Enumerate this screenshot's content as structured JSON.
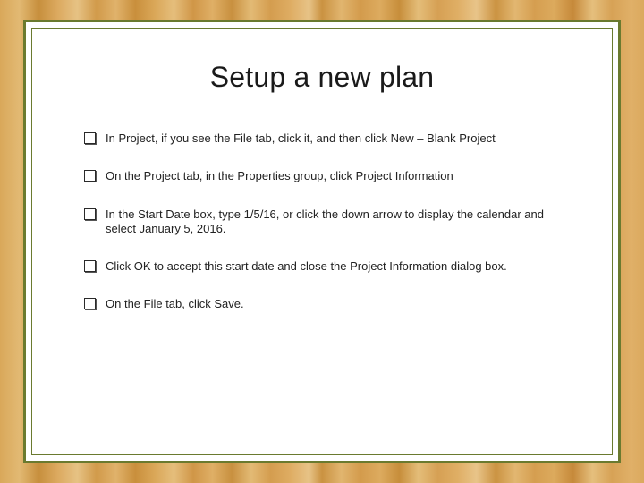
{
  "slide": {
    "title": "Setup a new plan",
    "bullets": [
      "In Project, if you see the File tab, click it, and then click New – Blank Project",
      "On the Project tab, in the Properties group, click Project Information",
      "In the Start Date box, type 1/5/16, or click the down arrow to display the calendar and select January 5, 2016.",
      "Click OK to accept this start date and close the Project Information dialog box.",
      "On the File tab, click Save."
    ]
  },
  "colors": {
    "border": "#6a7a2f"
  }
}
